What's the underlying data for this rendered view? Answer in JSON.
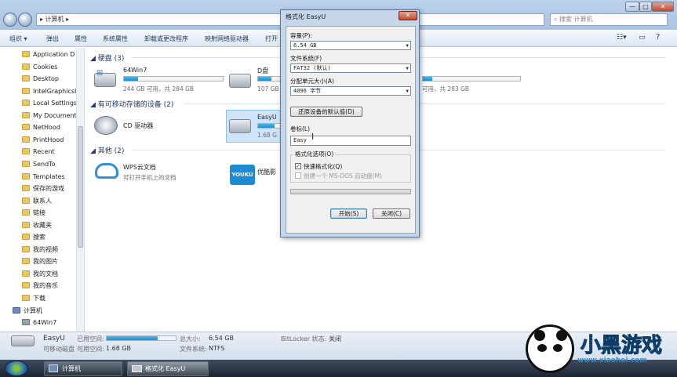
{
  "explorer": {
    "breadcrumb": "▸ 计算机 ▸",
    "search_placeholder": "搜索 计算机",
    "window_controls": {
      "minimize": "—",
      "maximize": "□",
      "close": "✕"
    },
    "toolbar": {
      "organize": "组织 ▾",
      "eject": "弹出",
      "properties": "属性",
      "system_properties": "系统属性",
      "uninstall": "卸载或更改程序",
      "map_drive": "映射网络驱动器",
      "open_panel": "打开"
    },
    "sidebar": [
      {
        "label": "Application D",
        "icon": "folder-icon"
      },
      {
        "label": "Cookies",
        "icon": "folder-icon"
      },
      {
        "label": "Desktop",
        "icon": "folder-icon"
      },
      {
        "label": "IntelGraphicsI",
        "icon": "folder-icon"
      },
      {
        "label": "Local Settings",
        "icon": "folder-icon"
      },
      {
        "label": "My Document",
        "icon": "folder-icon"
      },
      {
        "label": "NetHood",
        "icon": "folder-icon"
      },
      {
        "label": "PrintHood",
        "icon": "folder-icon"
      },
      {
        "label": "Recent",
        "icon": "folder-icon"
      },
      {
        "label": "SendTo",
        "icon": "folder-icon"
      },
      {
        "label": "Templates",
        "icon": "folder-icon"
      },
      {
        "label": "保存的游戏",
        "icon": "folder-icon"
      },
      {
        "label": "联系人",
        "icon": "folder-icon"
      },
      {
        "label": "链接",
        "icon": "folder-icon"
      },
      {
        "label": "收藏夹",
        "icon": "folder-icon"
      },
      {
        "label": "搜索",
        "icon": "folder-icon"
      },
      {
        "label": "我的视频",
        "icon": "folder-icon"
      },
      {
        "label": "我的图片",
        "icon": "folder-icon"
      },
      {
        "label": "我的文档",
        "icon": "folder-icon"
      },
      {
        "label": "我的音乐",
        "icon": "folder-icon"
      },
      {
        "label": "下载",
        "icon": "folder-icon"
      },
      {
        "label": "计算机",
        "icon": "computer-icon"
      },
      {
        "label": "64Win7",
        "icon": "disk-icon"
      }
    ],
    "groups": {
      "hard_disks": "硬盘 (3)",
      "removable": "有可移动存储的设备 (2)",
      "other": "其他 (2)"
    },
    "drives": {
      "win7": {
        "name": "64Win7",
        "sub": "244 GB 可用，共 284 GB",
        "used_fraction": 0.14
      },
      "d": {
        "name": "D盘",
        "sub": "107 GB 可用，",
        "used_fraction": 0.62
      },
      "third": {
        "sub": "可用，共 283 GB",
        "used_fraction": 0.1
      },
      "cd": {
        "name": "CD 驱动器"
      },
      "easyu": {
        "name": "EasyU",
        "sub": "1.68 G",
        "used_fraction": 0.74
      },
      "wps": {
        "name": "WPS云文档",
        "sub": "可打开手机上的文档"
      },
      "youku": {
        "name": "优酷影",
        "logo": "YOUKU"
      }
    },
    "status": {
      "name": "EasyU",
      "type": "可移动磁盘",
      "used_label": "已用空间:",
      "free_label": "可用空间:",
      "free_value": "1.68 GB",
      "total_label": "总大小:",
      "total_value": "6.54 GB",
      "fs_label": "文件系统:",
      "fs_value": "NTFS",
      "bitlocker_label": "BitLocker 状态:",
      "bitlocker_value": "关闭",
      "used_fraction": 0.74
    }
  },
  "taskbar": {
    "items": [
      {
        "label": "计算机"
      },
      {
        "label": "格式化 EasyU"
      }
    ]
  },
  "dialog": {
    "title": "格式化 EasyU",
    "close": "✕",
    "capacity_label": "容量(P):",
    "capacity_value": "6.54 GB",
    "fs_label": "文件系统(F)",
    "fs_value": "FAT32 (默认)",
    "alloc_label": "分配单元大小(A)",
    "alloc_value": "4096 字节",
    "restore_button": "还原设备的默认值(D)",
    "volume_label": "卷标(L)",
    "volume_value": "Easy",
    "options_label": "格式化选项(O)",
    "quick_format": "快速格式化(Q)",
    "msdos": "创建一个 MS-DOS 启动盘(M)",
    "start_button": "开始(S)",
    "close_button": "关闭(C)",
    "progress_fraction": 0
  },
  "watermark": {
    "text": "小黑游戏",
    "url": "www.xiaohei.com"
  },
  "colors": {
    "accent": "#2f76c8",
    "bar_fill": "#1f8ec9",
    "dialog_frame": "#c7d7ea"
  }
}
